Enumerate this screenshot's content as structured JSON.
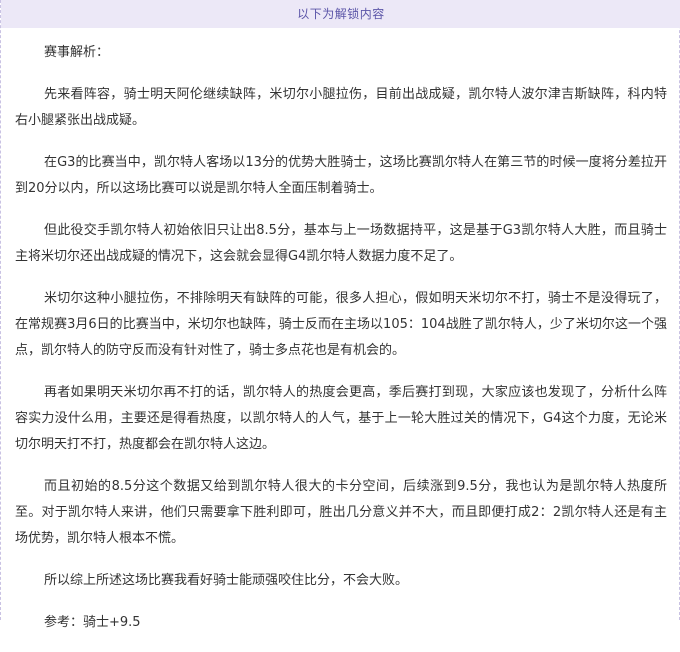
{
  "banner": {
    "text": "以下为解锁内容"
  },
  "article": {
    "heading": "赛事解析：",
    "paragraphs": [
      "先来看阵容，骑士明天阿伦继续缺阵，米切尔小腿拉伤，目前出战成疑，凯尔特人波尔津吉斯缺阵，科内特右小腿紧张出战成疑。",
      "在G3的比赛当中，凯尔特人客场以13分的优势大胜骑士，这场比赛凯尔特人在第三节的时候一度将分差拉开到20分以内，所以这场比赛可以说是凯尔特人全面压制着骑士。",
      "但此役交手凯尔特人初始依旧只让出8.5分，基本与上一场数据持平，这是基于G3凯尔特人大胜，而且骑士主将米切尔还出战成疑的情况下，这会就会显得G4凯尔特人数据力度不足了。",
      "米切尔这种小腿拉伤，不排除明天有缺阵的可能，很多人担心，假如明天米切尔不打，骑士不是没得玩了，在常规赛3月6日的比赛当中，米切尔也缺阵，骑士反而在主场以105：104战胜了凯尔特人，少了米切尔这一个强点，凯尔特人的防守反而没有针对性了，骑士多点花也是有机会的。",
      "再者如果明天米切尔再不打的话，凯尔特人的热度会更高，季后赛打到现，大家应该也发现了，分析什么阵容实力没什么用，主要还是得看热度，以凯尔特人的人气，基于上一轮大胜过关的情况下，G4这个力度，无论米切尔明天打不打，热度都会在凯尔特人这边。",
      "而且初始的8.5分这个数据又给到凯尔特人很大的卡分空间，后续涨到9.5分，我也认为是凯尔特人热度所至。对于凯尔特人来讲，他们只需要拿下胜利即可，胜出几分意义并不大，而且即便打成2：2凯尔特人还是有主场优势，凯尔特人根本不慌。",
      "所以综上所述这场比赛我看好骑士能顽强咬住比分，不会大败。"
    ],
    "reference": "参考：骑士+9.5"
  }
}
